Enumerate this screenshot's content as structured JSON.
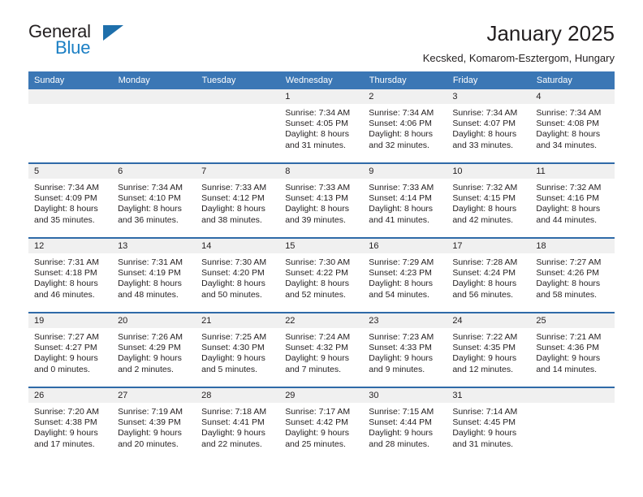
{
  "brand": {
    "name_top": "General",
    "name_bottom": "Blue",
    "triangle_color": "#1e6fab",
    "text_color": "#1b7fc4"
  },
  "header": {
    "title": "January 2025",
    "subtitle": "Kecsked, Komarom-Esztergom, Hungary",
    "header_bg": "#3b77b5",
    "row_divider": "#2f6aa8",
    "daynum_bg": "#f0f0f0"
  },
  "weekdays": [
    "Sunday",
    "Monday",
    "Tuesday",
    "Wednesday",
    "Thursday",
    "Friday",
    "Saturday"
  ],
  "weeks": [
    [
      {
        "day": "",
        "empty": true
      },
      {
        "day": "",
        "empty": true
      },
      {
        "day": "",
        "empty": true
      },
      {
        "day": "1",
        "sunrise": "Sunrise: 7:34 AM",
        "sunset": "Sunset: 4:05 PM",
        "daylight1": "Daylight: 8 hours",
        "daylight2": "and 31 minutes."
      },
      {
        "day": "2",
        "sunrise": "Sunrise: 7:34 AM",
        "sunset": "Sunset: 4:06 PM",
        "daylight1": "Daylight: 8 hours",
        "daylight2": "and 32 minutes."
      },
      {
        "day": "3",
        "sunrise": "Sunrise: 7:34 AM",
        "sunset": "Sunset: 4:07 PM",
        "daylight1": "Daylight: 8 hours",
        "daylight2": "and 33 minutes."
      },
      {
        "day": "4",
        "sunrise": "Sunrise: 7:34 AM",
        "sunset": "Sunset: 4:08 PM",
        "daylight1": "Daylight: 8 hours",
        "daylight2": "and 34 minutes."
      }
    ],
    [
      {
        "day": "5",
        "sunrise": "Sunrise: 7:34 AM",
        "sunset": "Sunset: 4:09 PM",
        "daylight1": "Daylight: 8 hours",
        "daylight2": "and 35 minutes."
      },
      {
        "day": "6",
        "sunrise": "Sunrise: 7:34 AM",
        "sunset": "Sunset: 4:10 PM",
        "daylight1": "Daylight: 8 hours",
        "daylight2": "and 36 minutes."
      },
      {
        "day": "7",
        "sunrise": "Sunrise: 7:33 AM",
        "sunset": "Sunset: 4:12 PM",
        "daylight1": "Daylight: 8 hours",
        "daylight2": "and 38 minutes."
      },
      {
        "day": "8",
        "sunrise": "Sunrise: 7:33 AM",
        "sunset": "Sunset: 4:13 PM",
        "daylight1": "Daylight: 8 hours",
        "daylight2": "and 39 minutes."
      },
      {
        "day": "9",
        "sunrise": "Sunrise: 7:33 AM",
        "sunset": "Sunset: 4:14 PM",
        "daylight1": "Daylight: 8 hours",
        "daylight2": "and 41 minutes."
      },
      {
        "day": "10",
        "sunrise": "Sunrise: 7:32 AM",
        "sunset": "Sunset: 4:15 PM",
        "daylight1": "Daylight: 8 hours",
        "daylight2": "and 42 minutes."
      },
      {
        "day": "11",
        "sunrise": "Sunrise: 7:32 AM",
        "sunset": "Sunset: 4:16 PM",
        "daylight1": "Daylight: 8 hours",
        "daylight2": "and 44 minutes."
      }
    ],
    [
      {
        "day": "12",
        "sunrise": "Sunrise: 7:31 AM",
        "sunset": "Sunset: 4:18 PM",
        "daylight1": "Daylight: 8 hours",
        "daylight2": "and 46 minutes."
      },
      {
        "day": "13",
        "sunrise": "Sunrise: 7:31 AM",
        "sunset": "Sunset: 4:19 PM",
        "daylight1": "Daylight: 8 hours",
        "daylight2": "and 48 minutes."
      },
      {
        "day": "14",
        "sunrise": "Sunrise: 7:30 AM",
        "sunset": "Sunset: 4:20 PM",
        "daylight1": "Daylight: 8 hours",
        "daylight2": "and 50 minutes."
      },
      {
        "day": "15",
        "sunrise": "Sunrise: 7:30 AM",
        "sunset": "Sunset: 4:22 PM",
        "daylight1": "Daylight: 8 hours",
        "daylight2": "and 52 minutes."
      },
      {
        "day": "16",
        "sunrise": "Sunrise: 7:29 AM",
        "sunset": "Sunset: 4:23 PM",
        "daylight1": "Daylight: 8 hours",
        "daylight2": "and 54 minutes."
      },
      {
        "day": "17",
        "sunrise": "Sunrise: 7:28 AM",
        "sunset": "Sunset: 4:24 PM",
        "daylight1": "Daylight: 8 hours",
        "daylight2": "and 56 minutes."
      },
      {
        "day": "18",
        "sunrise": "Sunrise: 7:27 AM",
        "sunset": "Sunset: 4:26 PM",
        "daylight1": "Daylight: 8 hours",
        "daylight2": "and 58 minutes."
      }
    ],
    [
      {
        "day": "19",
        "sunrise": "Sunrise: 7:27 AM",
        "sunset": "Sunset: 4:27 PM",
        "daylight1": "Daylight: 9 hours",
        "daylight2": "and 0 minutes."
      },
      {
        "day": "20",
        "sunrise": "Sunrise: 7:26 AM",
        "sunset": "Sunset: 4:29 PM",
        "daylight1": "Daylight: 9 hours",
        "daylight2": "and 2 minutes."
      },
      {
        "day": "21",
        "sunrise": "Sunrise: 7:25 AM",
        "sunset": "Sunset: 4:30 PM",
        "daylight1": "Daylight: 9 hours",
        "daylight2": "and 5 minutes."
      },
      {
        "day": "22",
        "sunrise": "Sunrise: 7:24 AM",
        "sunset": "Sunset: 4:32 PM",
        "daylight1": "Daylight: 9 hours",
        "daylight2": "and 7 minutes."
      },
      {
        "day": "23",
        "sunrise": "Sunrise: 7:23 AM",
        "sunset": "Sunset: 4:33 PM",
        "daylight1": "Daylight: 9 hours",
        "daylight2": "and 9 minutes."
      },
      {
        "day": "24",
        "sunrise": "Sunrise: 7:22 AM",
        "sunset": "Sunset: 4:35 PM",
        "daylight1": "Daylight: 9 hours",
        "daylight2": "and 12 minutes."
      },
      {
        "day": "25",
        "sunrise": "Sunrise: 7:21 AM",
        "sunset": "Sunset: 4:36 PM",
        "daylight1": "Daylight: 9 hours",
        "daylight2": "and 14 minutes."
      }
    ],
    [
      {
        "day": "26",
        "sunrise": "Sunrise: 7:20 AM",
        "sunset": "Sunset: 4:38 PM",
        "daylight1": "Daylight: 9 hours",
        "daylight2": "and 17 minutes."
      },
      {
        "day": "27",
        "sunrise": "Sunrise: 7:19 AM",
        "sunset": "Sunset: 4:39 PM",
        "daylight1": "Daylight: 9 hours",
        "daylight2": "and 20 minutes."
      },
      {
        "day": "28",
        "sunrise": "Sunrise: 7:18 AM",
        "sunset": "Sunset: 4:41 PM",
        "daylight1": "Daylight: 9 hours",
        "daylight2": "and 22 minutes."
      },
      {
        "day": "29",
        "sunrise": "Sunrise: 7:17 AM",
        "sunset": "Sunset: 4:42 PM",
        "daylight1": "Daylight: 9 hours",
        "daylight2": "and 25 minutes."
      },
      {
        "day": "30",
        "sunrise": "Sunrise: 7:15 AM",
        "sunset": "Sunset: 4:44 PM",
        "daylight1": "Daylight: 9 hours",
        "daylight2": "and 28 minutes."
      },
      {
        "day": "31",
        "sunrise": "Sunrise: 7:14 AM",
        "sunset": "Sunset: 4:45 PM",
        "daylight1": "Daylight: 9 hours",
        "daylight2": "and 31 minutes."
      },
      {
        "day": "",
        "empty": true
      }
    ]
  ]
}
